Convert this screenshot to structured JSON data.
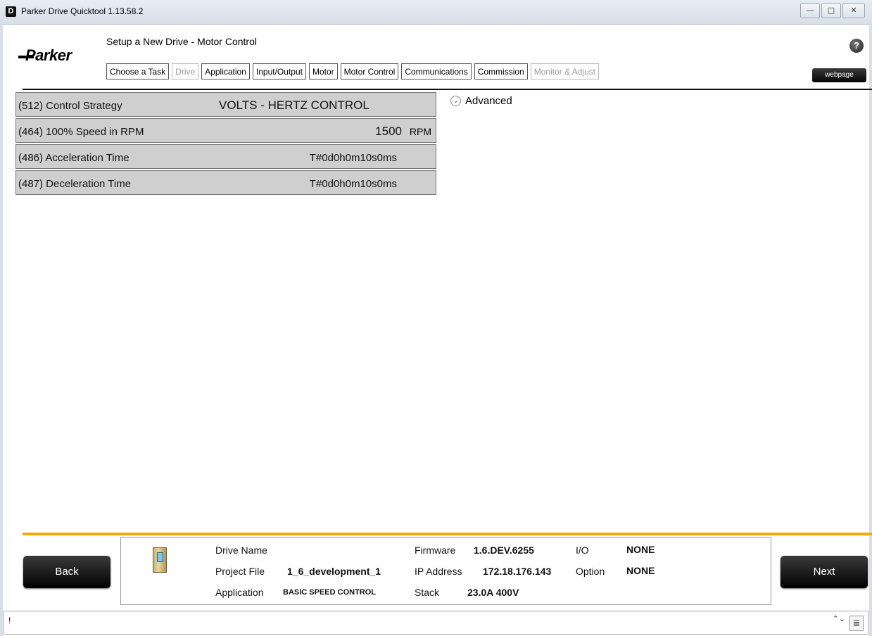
{
  "window": {
    "title": "Parker Drive Quicktool 1.13.58.2",
    "app_icon": "D",
    "minimize_icon": "—",
    "maximize_icon": "□",
    "close_icon": "✕"
  },
  "header": {
    "logo_text": "Parker",
    "heading": "Setup a New Drive - Motor Control",
    "help_icon": "?",
    "webpage_label": "webpage",
    "tabs": [
      {
        "label": "Choose a Task",
        "enabled": true
      },
      {
        "label": "Drive",
        "enabled": false
      },
      {
        "label": "Application",
        "enabled": true
      },
      {
        "label": "Input/Output",
        "enabled": true
      },
      {
        "label": "Motor",
        "enabled": true
      },
      {
        "label": "Motor Control",
        "enabled": true
      },
      {
        "label": "Communications",
        "enabled": true
      },
      {
        "label": "Commission",
        "enabled": true
      },
      {
        "label": "Monitor & Adjust",
        "enabled": false
      }
    ]
  },
  "params": [
    {
      "label": "(512) Control Strategy",
      "value": "VOLTS - HERTZ CONTROL"
    },
    {
      "label": "(464) 100% Speed in RPM",
      "value": "1500",
      "unit": "RPM"
    },
    {
      "label": "(486) Acceleration Time",
      "value": "T#0d0h0m10s0ms"
    },
    {
      "label": "(487) Deceleration Time",
      "value": "T#0d0h0m10s0ms"
    }
  ],
  "advanced": {
    "label": "Advanced",
    "icon": "⌄"
  },
  "footer": {
    "back_label": "Back",
    "next_label": "Next",
    "drive_name_label": "Drive Name",
    "project_file_label": "Project File",
    "project_file_value": "1_6_development_1",
    "application_label": "Application",
    "application_value": "BASIC SPEED CONTROL",
    "firmware_label": "Firmware",
    "firmware_value": "1.6.DEV.6255",
    "ip_label": "IP Address",
    "ip_value": "172.18.176.143",
    "stack_label": "Stack",
    "stack_value": "23.0A 400V",
    "io_label": "I/O",
    "io_value": "NONE",
    "option_label": "Option",
    "option_value": "NONE"
  },
  "statusbar": {
    "text": "!",
    "spinner_icon": "⌃⌄",
    "list_icon": "≣"
  },
  "colors": {
    "accent_orange": "#f5a800",
    "param_bg": "#cfcfcf",
    "button_black": "#000000"
  }
}
